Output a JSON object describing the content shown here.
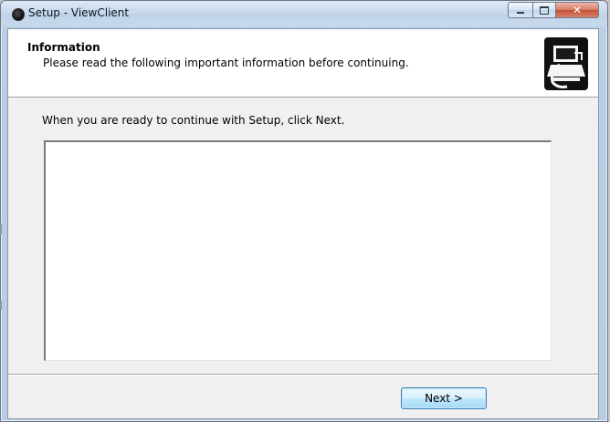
{
  "window": {
    "title": "Setup - ViewClient",
    "controls": {
      "minimize_icon": "minimize-icon",
      "maximize_icon": "maximize-icon",
      "close_icon": "close-icon"
    }
  },
  "header": {
    "title": "Information",
    "subtitle": "Please read the following important information before continuing.",
    "logo_icon": "setup-computer-icon"
  },
  "body": {
    "lead_text": "When you are ready to continue with Setup, click Next.",
    "info_text": ""
  },
  "footer": {
    "next_label": "Next >"
  },
  "colors": {
    "titlebar": "#c5d8ec",
    "client_bg": "#f0f0f0",
    "button_border": "#3c7fb1",
    "close_button": "#c55135"
  }
}
